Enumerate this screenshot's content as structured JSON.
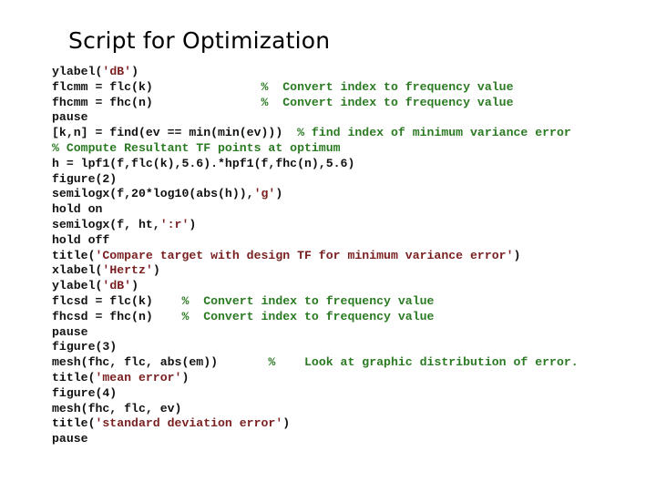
{
  "title": "Script for Optimization",
  "colors": {
    "text": "#111111",
    "string": "#7a1f1f",
    "comment": "#2a7a22"
  },
  "lines": [
    [
      {
        "t": "ylabel(",
        "k": "code"
      },
      {
        "t": "'dB'",
        "k": "str"
      },
      {
        "t": ")",
        "k": "code"
      }
    ],
    [
      {
        "t": "flcmm = flc(k)               ",
        "k": "code"
      },
      {
        "t": "%  Convert index to frequency value",
        "k": "cmt"
      }
    ],
    [
      {
        "t": "fhcmm = fhc(n)               ",
        "k": "code"
      },
      {
        "t": "%  Convert index to frequency value",
        "k": "cmt"
      }
    ],
    [
      {
        "t": "pause",
        "k": "code"
      }
    ],
    [
      {
        "t": "[k,n] = find(ev == min(min(ev)))  ",
        "k": "code"
      },
      {
        "t": "% find index of minimum variance error",
        "k": "cmt"
      }
    ],
    [
      {
        "t": "% Compute Resultant TF points at optimum",
        "k": "cmt"
      }
    ],
    [
      {
        "t": "h = lpf1(f,flc(k),5.6).*hpf1(f,fhc(n),5.6)",
        "k": "code"
      }
    ],
    [
      {
        "t": "figure(2)",
        "k": "code"
      }
    ],
    [
      {
        "t": "semilogx(f,20*log10(abs(h)),",
        "k": "code"
      },
      {
        "t": "'g'",
        "k": "str"
      },
      {
        "t": ")",
        "k": "code"
      }
    ],
    [
      {
        "t": "hold on",
        "k": "code"
      }
    ],
    [
      {
        "t": "semilogx(f, ht,",
        "k": "code"
      },
      {
        "t": "':r'",
        "k": "str"
      },
      {
        "t": ")",
        "k": "code"
      }
    ],
    [
      {
        "t": "hold off",
        "k": "code"
      }
    ],
    [
      {
        "t": "title(",
        "k": "code"
      },
      {
        "t": "'Compare target with design TF for minimum variance error'",
        "k": "str"
      },
      {
        "t": ")",
        "k": "code"
      }
    ],
    [
      {
        "t": "xlabel(",
        "k": "code"
      },
      {
        "t": "'Hertz'",
        "k": "str"
      },
      {
        "t": ")",
        "k": "code"
      }
    ],
    [
      {
        "t": "ylabel(",
        "k": "code"
      },
      {
        "t": "'dB'",
        "k": "str"
      },
      {
        "t": ")",
        "k": "code"
      }
    ],
    [
      {
        "t": "flcsd = flc(k)    ",
        "k": "code"
      },
      {
        "t": "%  Convert index to frequency value",
        "k": "cmt"
      }
    ],
    [
      {
        "t": "fhcsd = fhc(n)    ",
        "k": "code"
      },
      {
        "t": "%  Convert index to frequency value",
        "k": "cmt"
      }
    ],
    [
      {
        "t": "pause",
        "k": "code"
      }
    ],
    [
      {
        "t": "figure(3)",
        "k": "code"
      }
    ],
    [
      {
        "t": "mesh(fhc, flc, abs(em))       ",
        "k": "code"
      },
      {
        "t": "%    Look at graphic distribution of error.",
        "k": "cmt"
      }
    ],
    [
      {
        "t": "title(",
        "k": "code"
      },
      {
        "t": "'mean error'",
        "k": "str"
      },
      {
        "t": ")",
        "k": "code"
      }
    ],
    [
      {
        "t": "figure(4)",
        "k": "code"
      }
    ],
    [
      {
        "t": "mesh(fhc, flc, ev)",
        "k": "code"
      }
    ],
    [
      {
        "t": "title(",
        "k": "code"
      },
      {
        "t": "'standard deviation error'",
        "k": "str"
      },
      {
        "t": ")",
        "k": "code"
      }
    ],
    [
      {
        "t": "pause",
        "k": "code"
      }
    ]
  ]
}
